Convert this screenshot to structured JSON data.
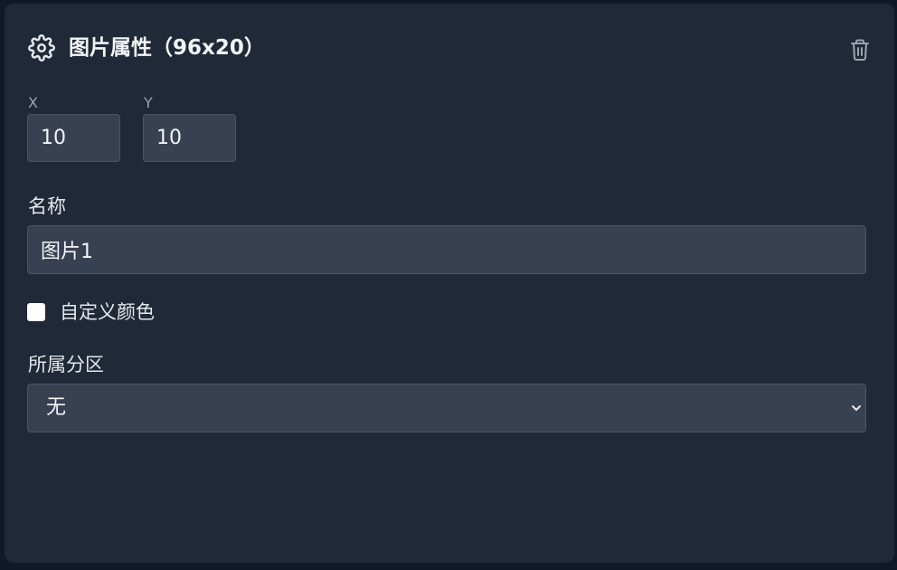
{
  "header": {
    "icon": "gear-icon",
    "title": "图片属性（96x20）",
    "delete_icon": "trash-icon"
  },
  "position": {
    "x_label": "X",
    "x_value": "10",
    "y_label": "Y",
    "y_value": "10"
  },
  "name_field": {
    "label": "名称",
    "value": "图片1"
  },
  "custom_color": {
    "label": "自定义颜色",
    "checked": false
  },
  "zone_field": {
    "label": "所属分区",
    "selected": "无"
  },
  "colors": {
    "panel_bg": "#1f2937",
    "input_bg": "#374151",
    "text": "#f3f4f6",
    "muted": "#9ca3af"
  }
}
